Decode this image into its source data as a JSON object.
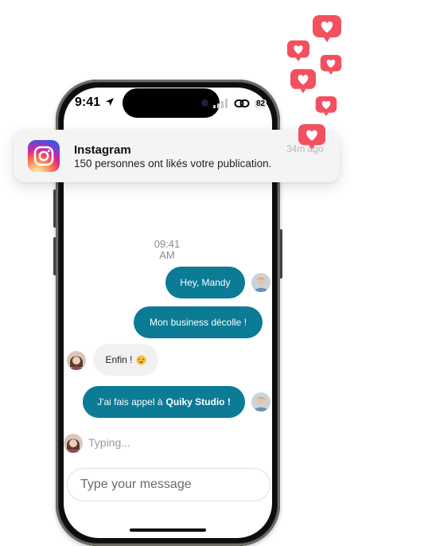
{
  "status_bar": {
    "time": "9:41",
    "battery": "82"
  },
  "notification": {
    "app": "Instagram",
    "message": "150 personnes ont likés votre publication.",
    "ago": "34m ago"
  },
  "chat": {
    "timestamp_time": "09:41",
    "timestamp_ampm": "AM",
    "messages": [
      {
        "from": "me",
        "text": "Hey, Mandy"
      },
      {
        "from": "me",
        "text": "Mon business décolle !"
      },
      {
        "from": "mandy",
        "text": "Enfin !"
      },
      {
        "from": "me",
        "text_prefix": "J'ai fais appel à",
        "text_bold": "Quiky Studio !"
      }
    ],
    "typing": "Typing...",
    "input_placeholder": "Type your message"
  },
  "colors": {
    "outgoing_bubble": "#0b7b96",
    "incoming_bubble": "#f1f1f3",
    "heart_badge": "#f2505f"
  },
  "icons": {
    "reaction": "heart-icon",
    "emoji": "star-struck-emoji-icon",
    "location": "location-arrow-icon",
    "link": "link-icon",
    "signal": "signal-bars-icon"
  }
}
